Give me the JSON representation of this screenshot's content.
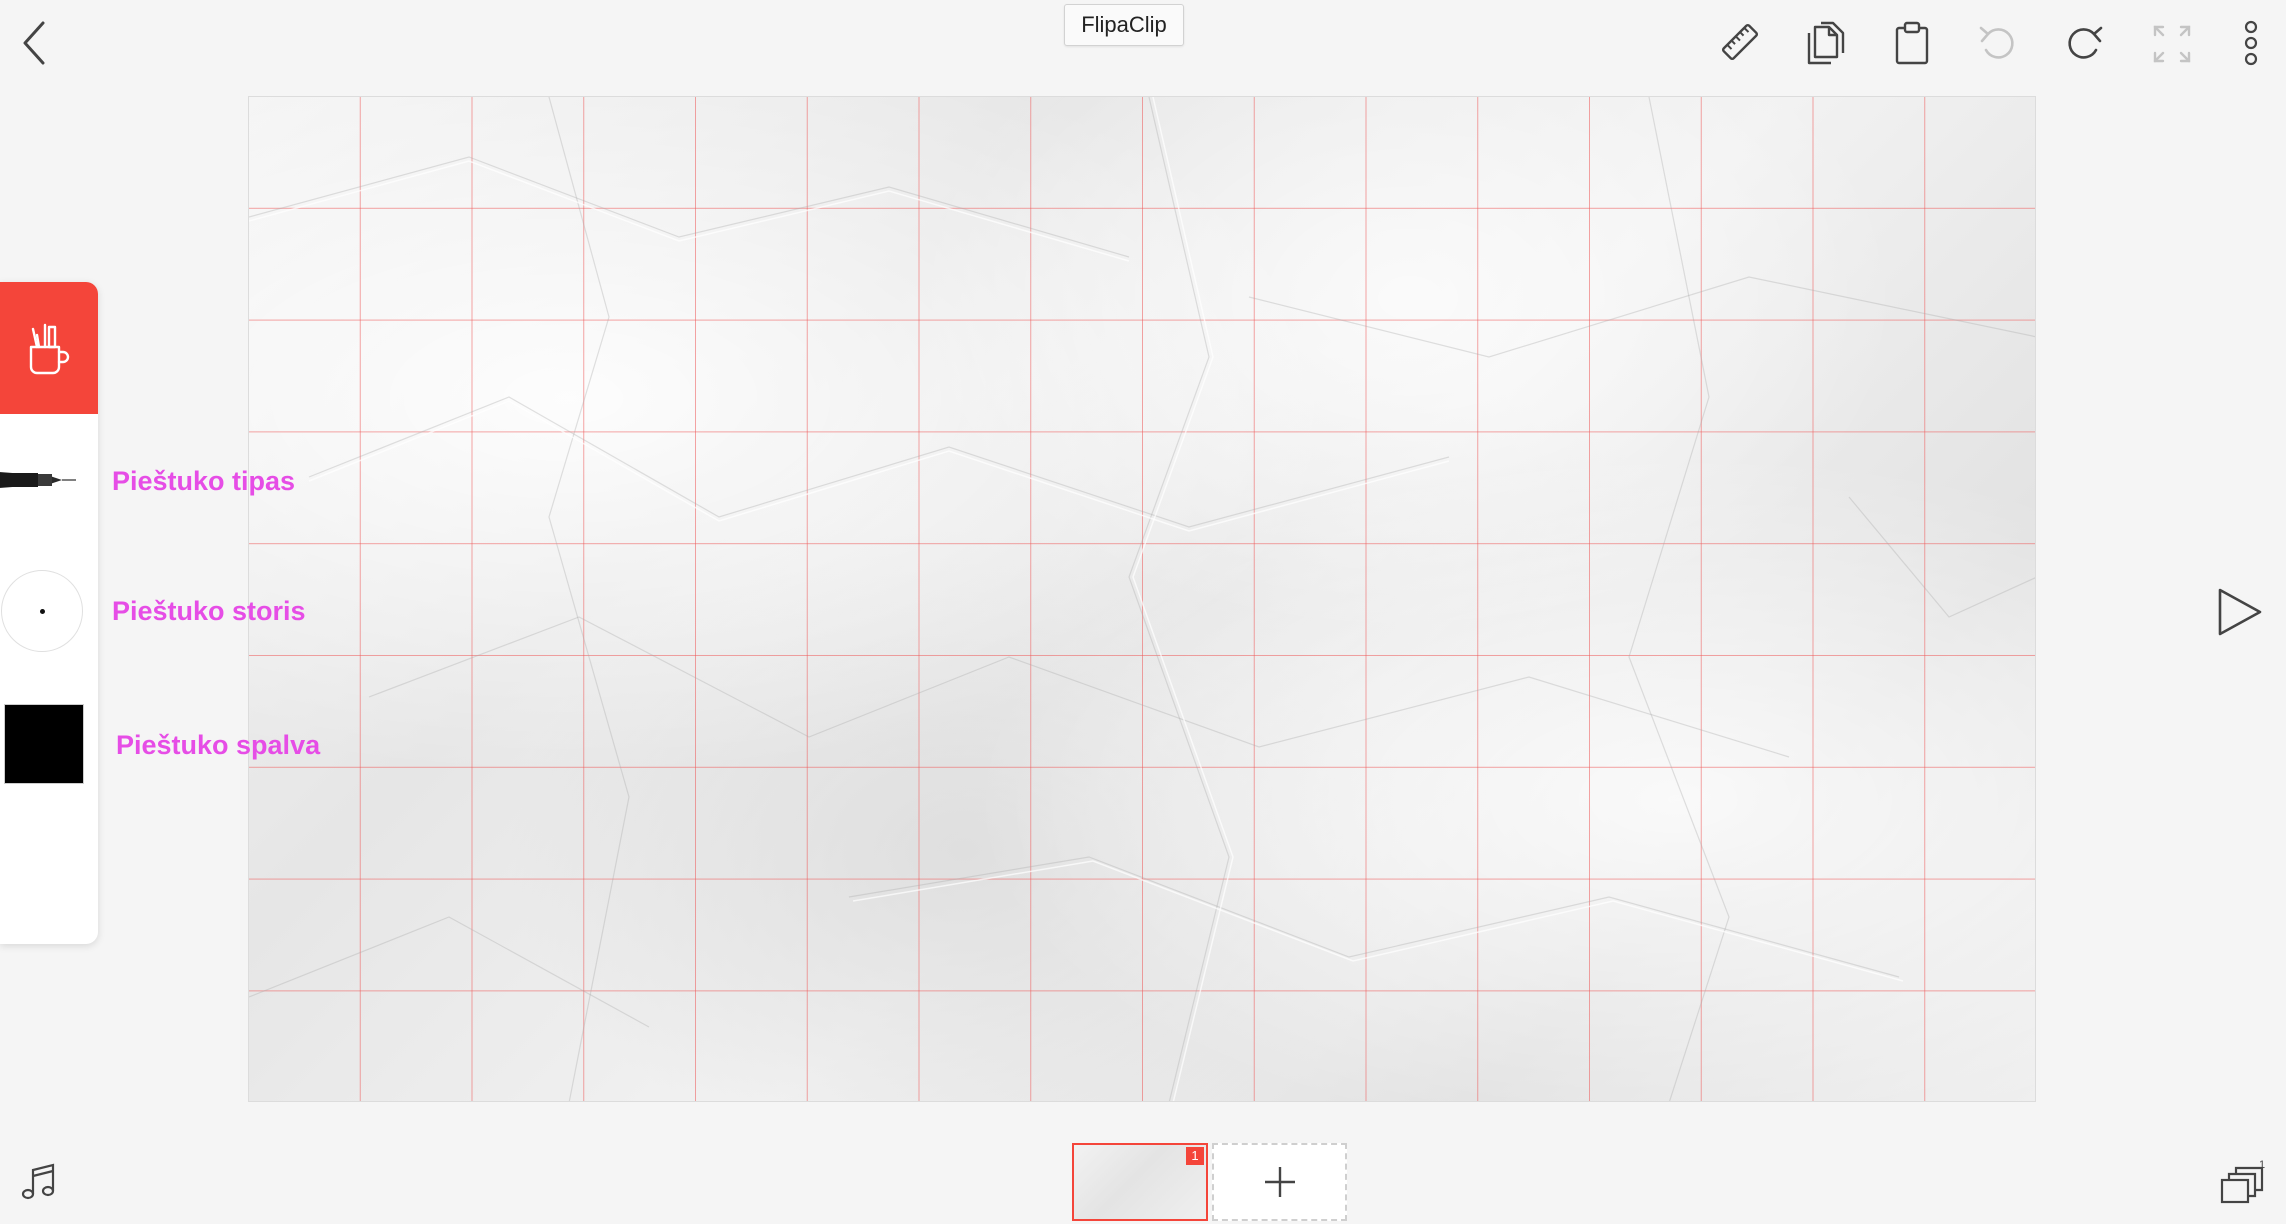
{
  "app": {
    "title": "FlipaClip"
  },
  "toolbar": {
    "back": "back-icon",
    "ruler": "ruler-icon",
    "copy": "copy-icon",
    "paste": "paste-icon",
    "undo": "undo-icon",
    "redo": "redo-icon",
    "fullscreen": "fullscreen-icon",
    "more": "more-icon"
  },
  "tools": {
    "brush_type_label": "Pieštuko tipas",
    "brush_size_label": "Pieštuko storis",
    "brush_color_label": "Pieštuko spalva",
    "brush_color": "#000000",
    "header_color": "#f4453a"
  },
  "timeline": {
    "frame_number": "1",
    "add_frame": "+"
  },
  "annotation_color": "#e64de6"
}
